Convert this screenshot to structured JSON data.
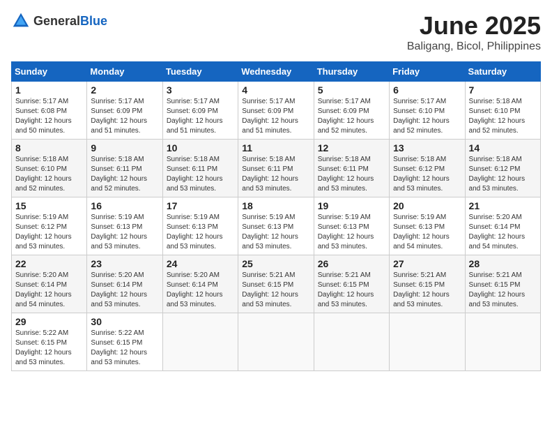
{
  "header": {
    "logo_general": "General",
    "logo_blue": "Blue",
    "month": "June 2025",
    "location": "Baligang, Bicol, Philippines"
  },
  "weekdays": [
    "Sunday",
    "Monday",
    "Tuesday",
    "Wednesday",
    "Thursday",
    "Friday",
    "Saturday"
  ],
  "weeks": [
    [
      {
        "day": "1",
        "info": "Sunrise: 5:17 AM\nSunset: 6:08 PM\nDaylight: 12 hours\nand 50 minutes."
      },
      {
        "day": "2",
        "info": "Sunrise: 5:17 AM\nSunset: 6:09 PM\nDaylight: 12 hours\nand 51 minutes."
      },
      {
        "day": "3",
        "info": "Sunrise: 5:17 AM\nSunset: 6:09 PM\nDaylight: 12 hours\nand 51 minutes."
      },
      {
        "day": "4",
        "info": "Sunrise: 5:17 AM\nSunset: 6:09 PM\nDaylight: 12 hours\nand 51 minutes."
      },
      {
        "day": "5",
        "info": "Sunrise: 5:17 AM\nSunset: 6:09 PM\nDaylight: 12 hours\nand 52 minutes."
      },
      {
        "day": "6",
        "info": "Sunrise: 5:17 AM\nSunset: 6:10 PM\nDaylight: 12 hours\nand 52 minutes."
      },
      {
        "day": "7",
        "info": "Sunrise: 5:18 AM\nSunset: 6:10 PM\nDaylight: 12 hours\nand 52 minutes."
      }
    ],
    [
      {
        "day": "8",
        "info": "Sunrise: 5:18 AM\nSunset: 6:10 PM\nDaylight: 12 hours\nand 52 minutes."
      },
      {
        "day": "9",
        "info": "Sunrise: 5:18 AM\nSunset: 6:11 PM\nDaylight: 12 hours\nand 52 minutes."
      },
      {
        "day": "10",
        "info": "Sunrise: 5:18 AM\nSunset: 6:11 PM\nDaylight: 12 hours\nand 53 minutes."
      },
      {
        "day": "11",
        "info": "Sunrise: 5:18 AM\nSunset: 6:11 PM\nDaylight: 12 hours\nand 53 minutes."
      },
      {
        "day": "12",
        "info": "Sunrise: 5:18 AM\nSunset: 6:11 PM\nDaylight: 12 hours\nand 53 minutes."
      },
      {
        "day": "13",
        "info": "Sunrise: 5:18 AM\nSunset: 6:12 PM\nDaylight: 12 hours\nand 53 minutes."
      },
      {
        "day": "14",
        "info": "Sunrise: 5:18 AM\nSunset: 6:12 PM\nDaylight: 12 hours\nand 53 minutes."
      }
    ],
    [
      {
        "day": "15",
        "info": "Sunrise: 5:19 AM\nSunset: 6:12 PM\nDaylight: 12 hours\nand 53 minutes."
      },
      {
        "day": "16",
        "info": "Sunrise: 5:19 AM\nSunset: 6:13 PM\nDaylight: 12 hours\nand 53 minutes."
      },
      {
        "day": "17",
        "info": "Sunrise: 5:19 AM\nSunset: 6:13 PM\nDaylight: 12 hours\nand 53 minutes."
      },
      {
        "day": "18",
        "info": "Sunrise: 5:19 AM\nSunset: 6:13 PM\nDaylight: 12 hours\nand 53 minutes."
      },
      {
        "day": "19",
        "info": "Sunrise: 5:19 AM\nSunset: 6:13 PM\nDaylight: 12 hours\nand 53 minutes."
      },
      {
        "day": "20",
        "info": "Sunrise: 5:19 AM\nSunset: 6:13 PM\nDaylight: 12 hours\nand 54 minutes."
      },
      {
        "day": "21",
        "info": "Sunrise: 5:20 AM\nSunset: 6:14 PM\nDaylight: 12 hours\nand 54 minutes."
      }
    ],
    [
      {
        "day": "22",
        "info": "Sunrise: 5:20 AM\nSunset: 6:14 PM\nDaylight: 12 hours\nand 54 minutes."
      },
      {
        "day": "23",
        "info": "Sunrise: 5:20 AM\nSunset: 6:14 PM\nDaylight: 12 hours\nand 53 minutes."
      },
      {
        "day": "24",
        "info": "Sunrise: 5:20 AM\nSunset: 6:14 PM\nDaylight: 12 hours\nand 53 minutes."
      },
      {
        "day": "25",
        "info": "Sunrise: 5:21 AM\nSunset: 6:15 PM\nDaylight: 12 hours\nand 53 minutes."
      },
      {
        "day": "26",
        "info": "Sunrise: 5:21 AM\nSunset: 6:15 PM\nDaylight: 12 hours\nand 53 minutes."
      },
      {
        "day": "27",
        "info": "Sunrise: 5:21 AM\nSunset: 6:15 PM\nDaylight: 12 hours\nand 53 minutes."
      },
      {
        "day": "28",
        "info": "Sunrise: 5:21 AM\nSunset: 6:15 PM\nDaylight: 12 hours\nand 53 minutes."
      }
    ],
    [
      {
        "day": "29",
        "info": "Sunrise: 5:22 AM\nSunset: 6:15 PM\nDaylight: 12 hours\nand 53 minutes."
      },
      {
        "day": "30",
        "info": "Sunrise: 5:22 AM\nSunset: 6:15 PM\nDaylight: 12 hours\nand 53 minutes."
      },
      {
        "day": "",
        "info": ""
      },
      {
        "day": "",
        "info": ""
      },
      {
        "day": "",
        "info": ""
      },
      {
        "day": "",
        "info": ""
      },
      {
        "day": "",
        "info": ""
      }
    ]
  ]
}
